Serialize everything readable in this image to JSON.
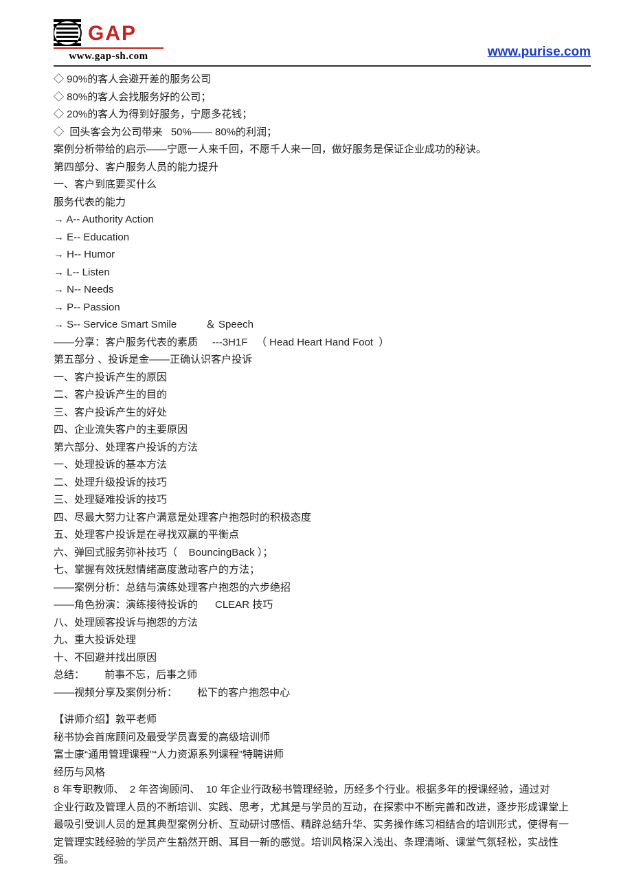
{
  "header": {
    "logo_url": "www.gap-sh.com",
    "logo_name": "GAP",
    "top_link": "www.purise.com"
  },
  "lines": [
    "◇ 90%的客人会避开差的服务公司",
    "◇ 80%的客人会找服务好的公司；",
    "◇ 20%的客人为得到好服务，宁愿多花钱；",
    "◇  回头客会为公司带来   50%—— 80%的利润；",
    "案例分析带给的启示——宁愿一人来千回，不愿千人来一回，做好服务是保证企业成功的秘诀。",
    "第四部分、客户服务人员的能力提升",
    "一、客户到底要买什么",
    "服务代表的能力",
    "→ A-- Authority Action",
    "→ E-- Education",
    "→ H-- Humor",
    "→ L-- Listen",
    "→ N-- Needs",
    "→ P-- Passion",
    "→ S-- Service Smart Smile          ＆ Speech",
    "――分享：客户服务代表的素质     ---3H1F   （ Head Heart Hand Foot  ）",
    "第五部分 、投诉是金——正确认识客户投诉",
    "一、客户投诉产生的原因",
    "二、客户投诉产生的目的",
    "三、客户投诉产生的好处",
    "四、企业流失客户的主要原因",
    "第六部分、处理客户投诉的方法",
    "一、处理投诉的基本方法",
    "二、处理升级投诉的技巧",
    "三、处理疑难投诉的技巧",
    "四、尽最大努力让客户满意是处理客户抱怨时的积极态度",
    "五、处理客户投诉是在寻找双赢的平衡点",
    "六、弹回式服务弥补技巧（    BouncingBack ）；",
    "七、掌握有效抚慰情绪高度激动客户的方法；",
    "――案例分析：总结与演练处理客户抱怨的六步绝招",
    "――角色扮演：演练接待投诉的      CLEAR 技巧",
    "八、处理顾客投诉与抱怨的方法",
    "九、重大投诉处理",
    "十、不回避并找出原因",
    "总结：       前事不忘，后事之师",
    "――视频分享及案例分析：       松下的客户抱怨中心",
    "",
    "【讲师介绍】敦平老师",
    "秘书协会首席顾问及最受学员喜爱的高级培训师",
    "富士康“通用管理课程”“人力资源系列课程”特聘讲师",
    "经历与风格",
    "8 年专职教师、  2 年咨询顾问、  10 年企业行政秘书管理经验，历经多个行业。根据多年的授课经验，通过对",
    "企业行政及管理人员的不断培训、实践、思考，尤其是与学员的互动，在探索中不断完善和改进，逐步形成课堂上最吸引受训人员的是其典型案例分析、互动研讨感悟、精辟总结升华、实务操作练习相结合的培训形式，使得有一定管理实践经验的学员产生豁然开朗、耳目一新的感觉。培训风格深入浅出、条理清晰、课堂气氛轻松，实战性强。"
  ]
}
